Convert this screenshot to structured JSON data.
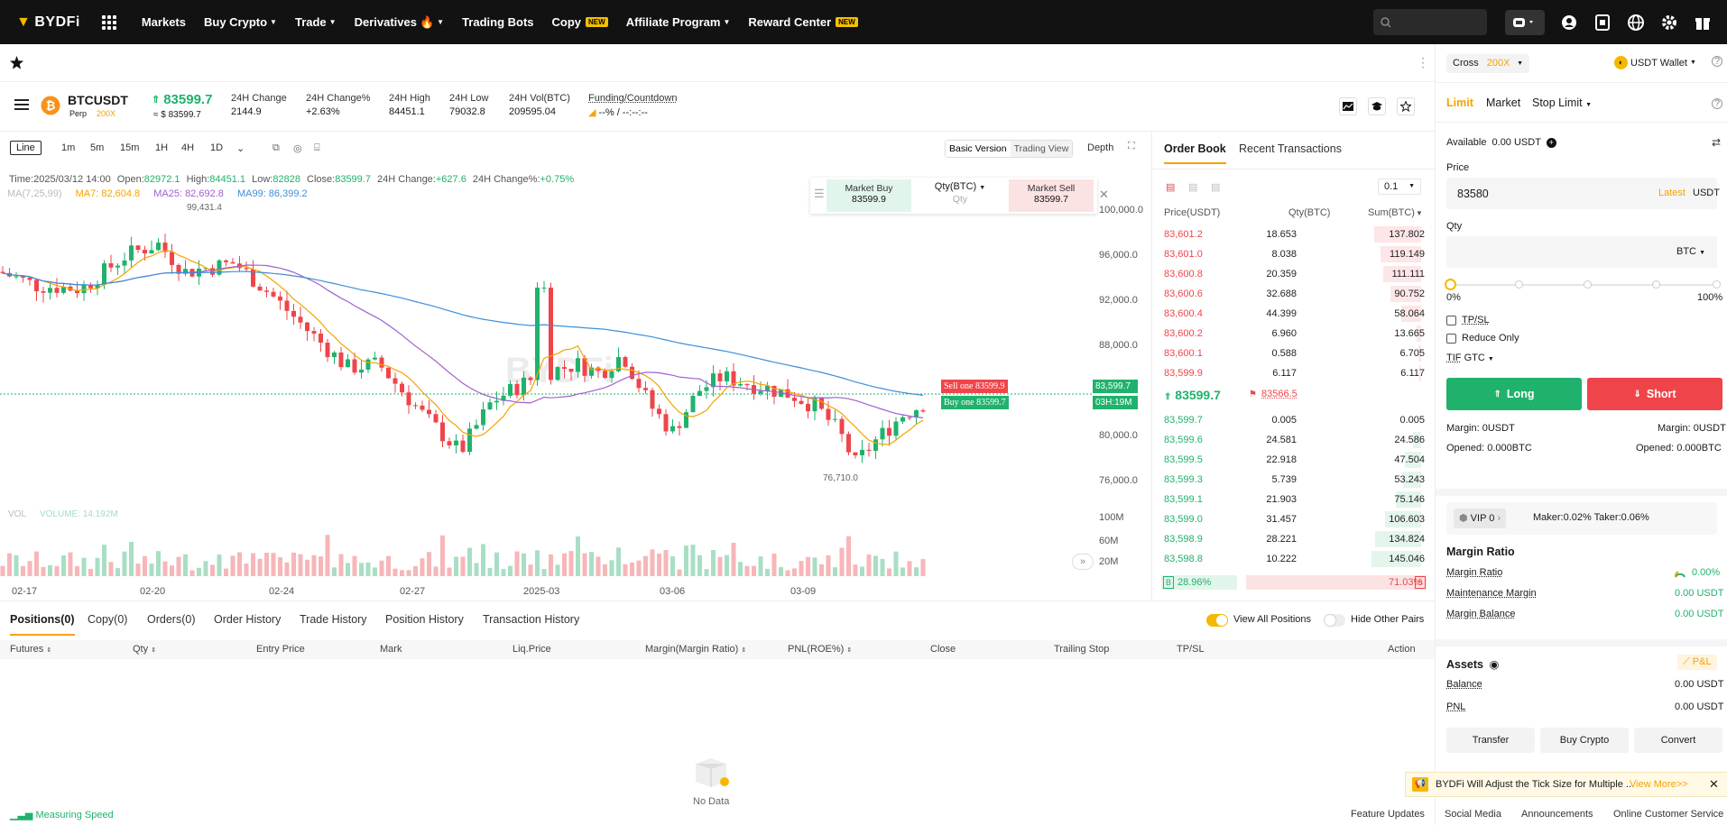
{
  "nav": {
    "brand": "BYDFi",
    "menu": [
      {
        "label": "Markets"
      },
      {
        "label": "Buy Crypto"
      },
      {
        "label": "Trade"
      },
      {
        "label": "Derivatives"
      },
      {
        "label": "Trading Bots"
      },
      {
        "label": "Copy"
      },
      {
        "label": "Affiliate Program"
      },
      {
        "label": "Reward Center"
      }
    ],
    "new_badge": "NEW"
  },
  "ticker": {
    "symbol": "BTCUSDT",
    "type": "Perp",
    "leverage": "200X",
    "last_price": "83599.7",
    "last_price_usd": "≈ $ 83599.7",
    "stats": [
      {
        "label": "24H Change",
        "value": "2144.9"
      },
      {
        "label": "24H Change%",
        "value": "+2.63%"
      },
      {
        "label": "24H High",
        "value": "84451.1"
      },
      {
        "label": "24H Low",
        "value": "79032.8"
      },
      {
        "label": "24H Vol(BTC)",
        "value": "209595.04"
      }
    ],
    "funding_label": "Funding/Countdown",
    "funding_value": "--% / --:--:--"
  },
  "toolbar": {
    "style": "Line",
    "intervals": [
      "1m",
      "5m",
      "15m",
      "1H",
      "4H",
      "1D"
    ],
    "active_interval": "4H",
    "basic_version": "Basic Version",
    "trading_view": "Trading View",
    "depth": "Depth"
  },
  "chart": {
    "info": {
      "time_label": "Time:",
      "time": "2025/03/12 14:00",
      "open_label": "Open:",
      "open": "82972.1",
      "high_label": "High:",
      "high": "84451.1",
      "low_label": "Low:",
      "low": "82828",
      "close_label": "Close:",
      "close": "83599.7",
      "chg_label": "24H Change:",
      "chg": "+627.6",
      "chgp_label": "24H Change%:",
      "chgp": "+0.75%"
    },
    "ma_label": "MA(7,25,99)",
    "ma7": "MA7: 82,604.8",
    "ma25": "MA25: 82,692.8",
    "ma99": "MA99: 86,399.2",
    "high_mark": "99,431.4",
    "low_mark": "76,710.0",
    "sell_one": "Sell one 83599.9",
    "buy_one": "Buy one 83599.7",
    "last_tag": "83,599.7",
    "countdown": "03H:19M",
    "vol_label": "VOL",
    "volume_label": "VOLUME: 14.192M",
    "y_ticks": [
      "100,000.0",
      "96,000.0",
      "92,000.0",
      "88,000.0",
      "84,000.0",
      "80,000.0",
      "76,000.0"
    ],
    "vol_ticks": [
      "100M",
      "60M",
      "20M"
    ],
    "x_ticks": [
      "02-17",
      "02-20",
      "02-24",
      "02-27",
      "2025-03",
      "03-06",
      "03-09"
    ],
    "market_buy": "Market Buy",
    "market_buy_price": "83599.9",
    "qty_label": "Qty(BTC)",
    "qty_placeholder": "Qty",
    "market_sell": "Market Sell",
    "market_sell_price": "83599.7"
  },
  "orderbook": {
    "tabs": [
      "Order Book",
      "Recent Transactions"
    ],
    "precision": "0.1",
    "headers": [
      "Price(USDT)",
      "Qty(BTC)",
      "Sum(BTC)"
    ],
    "asks": [
      [
        "83,601.2",
        "18.653",
        "137.802"
      ],
      [
        "83,601.0",
        "8.038",
        "119.149"
      ],
      [
        "83,600.8",
        "20.359",
        "111.111"
      ],
      [
        "83,600.6",
        "32.688",
        "90.752"
      ],
      [
        "83,600.4",
        "44.399",
        "58.064"
      ],
      [
        "83,600.2",
        "6.960",
        "13.665"
      ],
      [
        "83,600.1",
        "0.588",
        "6.705"
      ],
      [
        "83,599.9",
        "6.117",
        "6.117"
      ]
    ],
    "mid_price": "83599.7",
    "mark_price": "83566.5",
    "bids": [
      [
        "83,599.7",
        "0.005",
        "0.005"
      ],
      [
        "83,599.6",
        "24.581",
        "24.586"
      ],
      [
        "83,599.5",
        "22.918",
        "47.504"
      ],
      [
        "83,599.3",
        "5.739",
        "53.243"
      ],
      [
        "83,599.1",
        "21.903",
        "75.146"
      ],
      [
        "83,599.0",
        "31.457",
        "106.603"
      ],
      [
        "83,598.9",
        "28.221",
        "134.824"
      ],
      [
        "83,598.8",
        "10.222",
        "145.046"
      ]
    ],
    "buy_label": "B",
    "buy_pct": "28.96%",
    "sell_label": "S",
    "sell_pct": "71.03%"
  },
  "positions": {
    "tabs": [
      "Positions(0)",
      "Copy(0)",
      "Orders(0)",
      "Order History",
      "Trade History",
      "Position History",
      "Transaction History"
    ],
    "view_all": "View All Positions",
    "hide_other": "Hide Other Pairs",
    "columns": [
      "Futures",
      "Qty",
      "Entry Price",
      "Mark",
      "Liq.Price",
      "Margin(Margin Ratio)",
      "PNL(ROE%)",
      "Close",
      "Trailing Stop",
      "TP/SL",
      "Action"
    ],
    "empty": "No Data"
  },
  "order": {
    "margin_mode": "Cross",
    "leverage": "200X",
    "wallet": "USDT Wallet",
    "types": [
      "Limit",
      "Market",
      "Stop Limit"
    ],
    "available_label": "Available",
    "available": "0.00 USDT",
    "price_label": "Price",
    "price": "83580",
    "latest": "Latest",
    "price_unit": "USDT",
    "qty_label": "Qty",
    "qty_unit": "BTC",
    "slider_min": "0%",
    "slider_max": "100%",
    "tpsl": "TP/SL",
    "reduce_only": "Reduce Only",
    "tif_label": "TIF",
    "tif": "GTC",
    "long": "Long",
    "short": "Short",
    "margin_long": "Margin: 0USDT",
    "margin_short": "Margin: 0USDT",
    "opened_long": "Opened: 0.000BTC",
    "opened_short": "Opened: 0.000BTC",
    "vip": "VIP 0",
    "fees": "Maker:0.02% Taker:0.06%",
    "margin_ratio_title": "Margin Ratio",
    "margin_rows": [
      {
        "label": "Margin Ratio",
        "value": "0.00%"
      },
      {
        "label": "Maintenance Margin",
        "value": "0.00 USDT"
      },
      {
        "label": "Margin Balance",
        "value": "0.00 USDT"
      }
    ],
    "assets_title": "Assets",
    "pnl_btn": "P&L",
    "asset_rows": [
      {
        "label": "Balance",
        "value": "0.00 USDT"
      },
      {
        "label": "PNL",
        "value": "0.00 USDT"
      }
    ],
    "actions": [
      "Transfer",
      "Buy Crypto",
      "Convert"
    ],
    "notice": "BYDFi Will Adjust the Tick Size for Multiple ...",
    "view_more": "View More>>"
  },
  "footer": {
    "speed": "Measuring Speed",
    "links": [
      "Feature Updates",
      "Social Media",
      "Announcements",
      "Online Customer Service"
    ]
  },
  "colors": {
    "up": "#20b26c",
    "down": "#ef454a",
    "accent": "#f5a300",
    "ma7": "#f5a300",
    "ma25": "#a060d0",
    "ma99": "#3d8fd8"
  }
}
